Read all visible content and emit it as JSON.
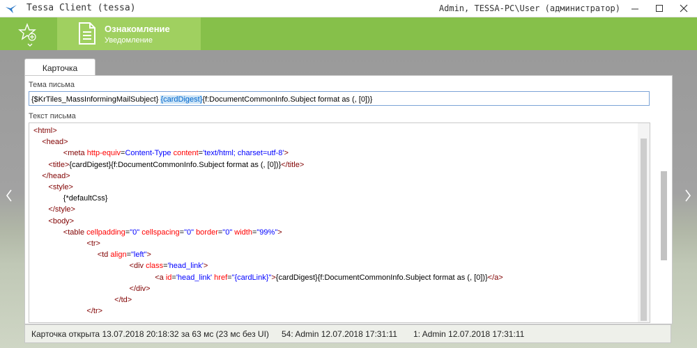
{
  "window": {
    "title": "Tessa Client (tessa)",
    "user_info": "Admin, TESSA-PC\\User (администратор)",
    "icons": {
      "app": "tessa-logo-icon",
      "minimize": "minimize-icon",
      "maximize": "maximize-icon",
      "close": "close-icon"
    }
  },
  "ribbon": {
    "favorites_icon": "star-plus-icon",
    "expand_icon": "chevron-down-icon",
    "active_tile": {
      "title": "Ознакомление",
      "subtitle": "Уведомление",
      "icon": "document-icon"
    },
    "color": "#86c04a",
    "active_color": "#a0d060"
  },
  "tabs": [
    {
      "label": "Карточка",
      "active": true
    }
  ],
  "form": {
    "subject_label": "Тема письма",
    "subject": {
      "before": "{$KrTiles_MassInformingMailSubject} ",
      "selected": "{cardDigest}",
      "after": "{f:DocumentCommonInfo.Subject format as (, [0])}"
    },
    "body_label": "Текст письма",
    "body_lines": [
      [
        {
          "c": "tg",
          "t": "<html>"
        }
      ],
      [
        {
          "c": "tx",
          "t": "    "
        },
        {
          "c": "tg",
          "t": "<head>"
        }
      ],
      [
        {
          "c": "tx",
          "t": "              "
        },
        {
          "c": "tg",
          "t": "<meta "
        },
        {
          "c": "at",
          "t": "http-equiv"
        },
        {
          "c": "tx",
          "t": "="
        },
        {
          "c": "av",
          "t": "Content-Type "
        },
        {
          "c": "at",
          "t": "content"
        },
        {
          "c": "tx",
          "t": "="
        },
        {
          "c": "av",
          "t": "'text/html; charset=utf-8'"
        },
        {
          "c": "tg",
          "t": ">"
        }
      ],
      [
        {
          "c": "tx",
          "t": "       "
        },
        {
          "c": "tg",
          "t": "<title>"
        },
        {
          "c": "tx",
          "t": "{cardDigest}{f:DocumentCommonInfo.Subject format as (, [0])}"
        },
        {
          "c": "tg",
          "t": "</title>"
        }
      ],
      [
        {
          "c": "tx",
          "t": "    "
        },
        {
          "c": "tg",
          "t": "</head>"
        }
      ],
      [
        {
          "c": "tx",
          "t": "       "
        },
        {
          "c": "tg",
          "t": "<style>"
        }
      ],
      [
        {
          "c": "tx",
          "t": "              {*defaultCss}"
        }
      ],
      [
        {
          "c": "tx",
          "t": "       "
        },
        {
          "c": "tg",
          "t": "</style>"
        }
      ],
      [
        {
          "c": "tx",
          "t": "       "
        },
        {
          "c": "tg",
          "t": "<body>"
        }
      ],
      [
        {
          "c": "tx",
          "t": "              "
        },
        {
          "c": "tg",
          "t": "<table "
        },
        {
          "c": "at",
          "t": "cellpadding"
        },
        {
          "c": "tx",
          "t": "="
        },
        {
          "c": "av",
          "t": "\"0\" "
        },
        {
          "c": "at",
          "t": "cellspacing"
        },
        {
          "c": "tx",
          "t": "="
        },
        {
          "c": "av",
          "t": "\"0\" "
        },
        {
          "c": "at",
          "t": "border"
        },
        {
          "c": "tx",
          "t": "="
        },
        {
          "c": "av",
          "t": "\"0\" "
        },
        {
          "c": "at",
          "t": "width"
        },
        {
          "c": "tx",
          "t": "="
        },
        {
          "c": "av",
          "t": "\"99%\""
        },
        {
          "c": "tg",
          "t": ">"
        }
      ],
      [
        {
          "c": "tx",
          "t": "                         "
        },
        {
          "c": "tg",
          "t": "<tr>"
        }
      ],
      [
        {
          "c": "tx",
          "t": "                              "
        },
        {
          "c": "tg",
          "t": "<td "
        },
        {
          "c": "at",
          "t": "align"
        },
        {
          "c": "tx",
          "t": "="
        },
        {
          "c": "av",
          "t": "\"left\""
        },
        {
          "c": "tg",
          "t": ">"
        }
      ],
      [
        {
          "c": "tx",
          "t": "                                             "
        },
        {
          "c": "tg",
          "t": "<div "
        },
        {
          "c": "at",
          "t": "class"
        },
        {
          "c": "tx",
          "t": "="
        },
        {
          "c": "av",
          "t": "'head_link'"
        },
        {
          "c": "tg",
          "t": ">"
        }
      ],
      [
        {
          "c": "tx",
          "t": "                                                         "
        },
        {
          "c": "tg",
          "t": "<a "
        },
        {
          "c": "at",
          "t": "id"
        },
        {
          "c": "tx",
          "t": "="
        },
        {
          "c": "av",
          "t": "'head_link' "
        },
        {
          "c": "at",
          "t": "href"
        },
        {
          "c": "tx",
          "t": "="
        },
        {
          "c": "av",
          "t": "\"{cardLink}\""
        },
        {
          "c": "tg",
          "t": ">"
        },
        {
          "c": "tx",
          "t": "{cardDigest}{f:DocumentCommonInfo.Subject format as (, [0])}"
        },
        {
          "c": "tg",
          "t": "</a>"
        }
      ],
      [
        {
          "c": "tx",
          "t": "                                             "
        },
        {
          "c": "tg",
          "t": "</div>"
        }
      ],
      [
        {
          "c": "tx",
          "t": "                                      "
        },
        {
          "c": "tg",
          "t": "</td>"
        }
      ],
      [
        {
          "c": "tx",
          "t": "                         "
        },
        {
          "c": "tg",
          "t": "</tr>"
        }
      ]
    ],
    "syntax_colors": {
      "tag": "#800000",
      "attr": "#ff0000",
      "value": "#0000ff"
    }
  },
  "status": {
    "opened": "Карточка открыта 13.07.2018 20:18:32 за 63 мс (23 мс без UI)",
    "version": "54:  Admin  12.07.2018 17:31:11",
    "created": "1:  Admin  12.07.2018 17:31:11"
  },
  "side_nav": {
    "left_icon": "chevron-left-icon",
    "right_icon": "chevron-right-icon"
  }
}
